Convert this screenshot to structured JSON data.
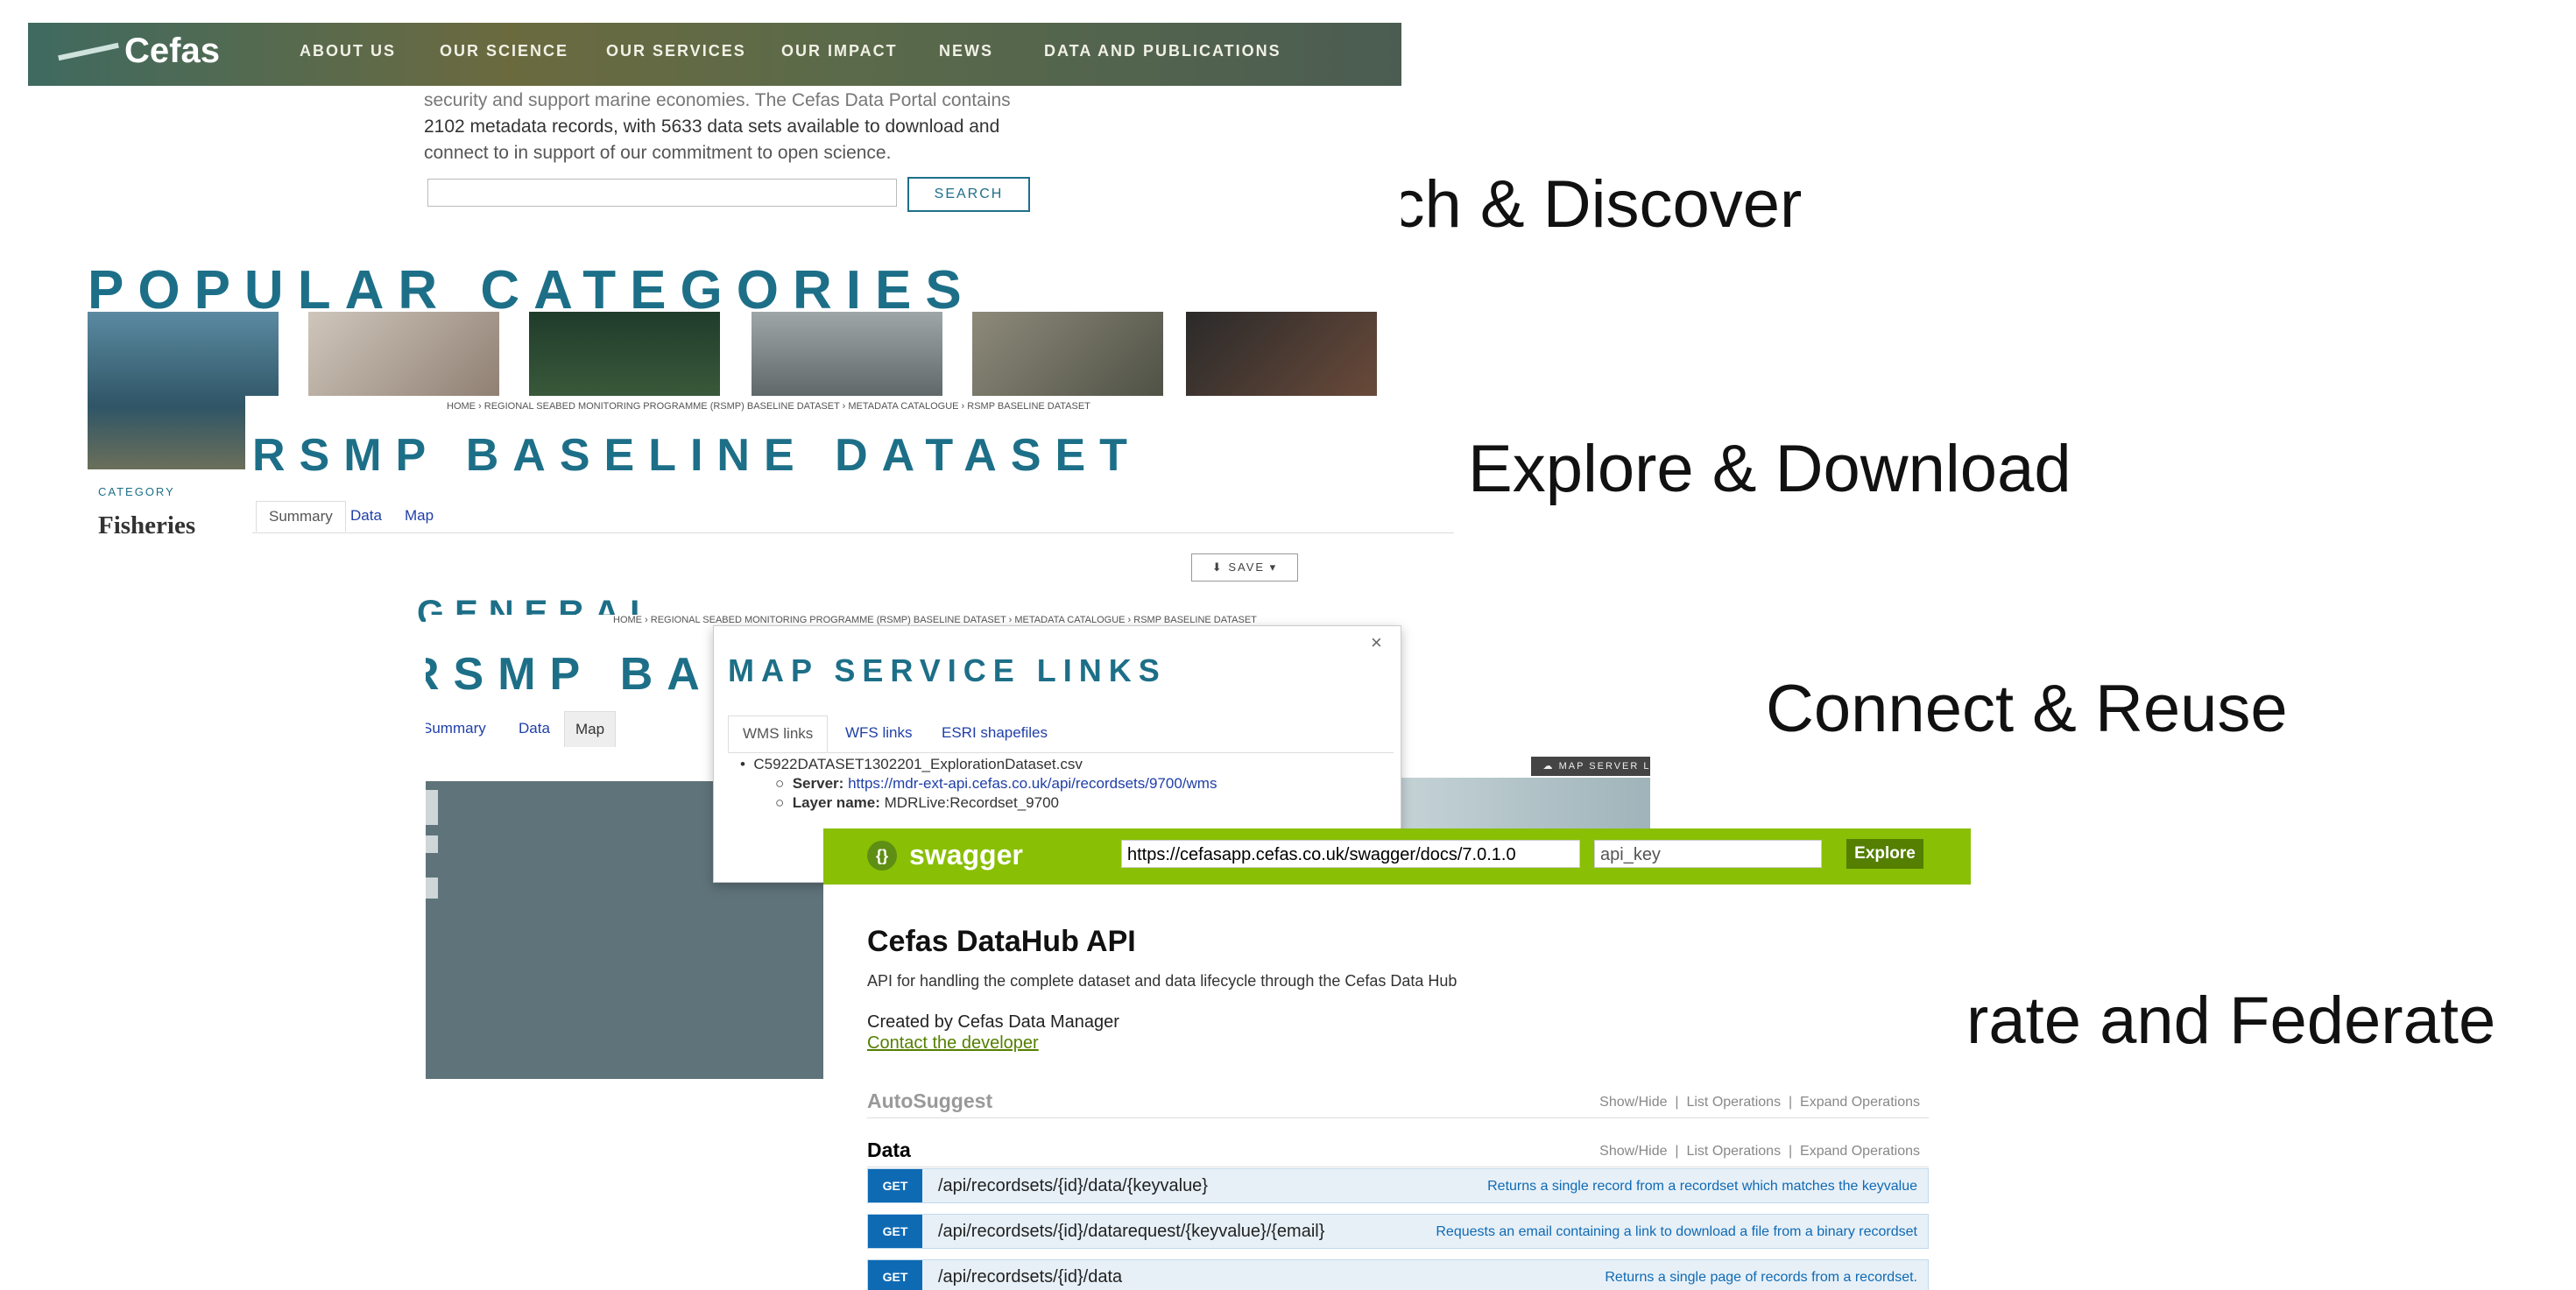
{
  "captions": {
    "search": "Search & Discover",
    "explore": "Explore & Download",
    "connect": "Connect & Reuse",
    "integrate": "Integrate and Federate"
  },
  "cefas_home": {
    "logo": "Cefas",
    "nav": [
      "ABOUT US",
      "OUR SCIENCE",
      "OUR SERVICES",
      "OUR IMPACT",
      "NEWS",
      "DATA AND PUBLICATIONS"
    ],
    "intro_line1": "security and support marine economies. The Cefas Data Portal contains",
    "intro_line2": "2102 metadata records, with 5633 data sets available to download and",
    "intro_line3": "connect to in support of our commitment to open science.",
    "search_button": "SEARCH",
    "popular_title": "POPULAR CATEGORIES",
    "category_label": "CATEGORY",
    "category_name": "Fisheries"
  },
  "dataset_page": {
    "breadcrumb": "HOME › REGIONAL SEABED MONITORING PROGRAMME (RSMP) BASELINE DATASET › METADATA CATALOGUE › RSMP BASELINE DATASET",
    "title": "RSMP BASELINE DATASET",
    "tabs": [
      "Summary",
      "Data",
      "Map"
    ],
    "save_button": "SAVE",
    "section": "GENERAL"
  },
  "map_page": {
    "breadcrumb": "HOME › REGIONAL SEABED MONITORING PROGRAMME (RSMP) BASELINE DATASET › METADATA CATALOGUE › RSMP BASELINE DATASET",
    "title": "RSMP BAS",
    "tabs": [
      "Summary",
      "Data",
      "Map"
    ],
    "map_server_button": "MAP SERVER L",
    "modal": {
      "title": "MAP SERVICE LINKS",
      "close": "×",
      "tabs": [
        "WMS links",
        "WFS links",
        "ESRI shapefiles"
      ],
      "file": "C5922DATASET1302201_ExplorationDataset.csv",
      "server_label": "Server:",
      "server_url": "https://mdr-ext-api.cefas.co.uk/api/recordsets/9700/wms",
      "layer_label": "Layer name:",
      "layer_name": "MDRLive:Recordset_9700"
    }
  },
  "swagger": {
    "brand": "swagger",
    "url": "https://cefasapp.cefas.co.uk/swagger/docs/7.0.1.0",
    "api_key_placeholder": "api_key",
    "explore_button": "Explore",
    "api_title": "Cefas DataHub API",
    "api_desc": "API for handling the complete dataset and data lifecycle through the Cefas Data Hub",
    "created_by": "Created by Cefas Data Manager",
    "contact": "Contact the developer",
    "ops_show_hide": "Show/Hide",
    "ops_list": "List Operations",
    "ops_expand": "Expand Operations",
    "groups": [
      "AutoSuggest",
      "Data"
    ],
    "endpoints": [
      {
        "method": "GET",
        "path": "/api/recordsets/{id}/data/{keyvalue}",
        "desc": "Returns a single record from a recordset which matches the keyvalue"
      },
      {
        "method": "GET",
        "path": "/api/recordsets/{id}/datarequest/{keyvalue}/{email}",
        "desc": "Requests an email containing a link to download a file from a binary recordset"
      },
      {
        "method": "GET",
        "path": "/api/recordsets/{id}/data",
        "desc": "Returns a single page of records from a recordset."
      }
    ]
  },
  "colors": {
    "cefas_teal": "#1d6f88",
    "swagger_green": "#89bf04",
    "get_blue": "#0f6ab4"
  }
}
